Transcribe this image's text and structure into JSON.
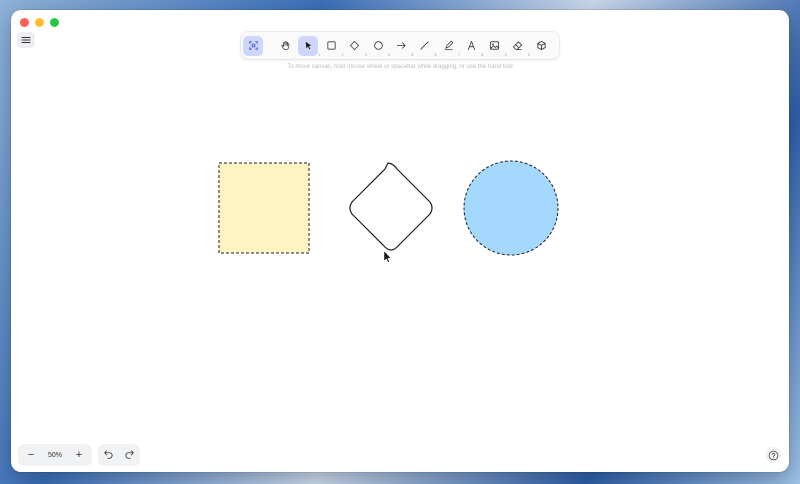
{
  "window": {
    "traffic_lights": [
      "close",
      "minimize",
      "maximize"
    ],
    "colors": {
      "close": "#ff5f57",
      "minimize": "#febc2e",
      "maximize": "#28c840"
    }
  },
  "toolbar": {
    "tools": [
      {
        "name": "lock-tool",
        "icon": "lock-icon",
        "shortcut": "",
        "active": true
      },
      {
        "name": "hand-tool",
        "icon": "hand-icon",
        "shortcut": "",
        "active": false
      },
      {
        "name": "selection-tool",
        "icon": "pointer-icon",
        "shortcut": "1",
        "active": true
      },
      {
        "name": "rectangle-tool",
        "icon": "square-icon",
        "shortcut": "2",
        "active": false
      },
      {
        "name": "diamond-tool",
        "icon": "diamond-icon",
        "shortcut": "3",
        "active": false
      },
      {
        "name": "ellipse-tool",
        "icon": "circle-icon",
        "shortcut": "4",
        "active": false
      },
      {
        "name": "arrow-tool",
        "icon": "arrow-icon",
        "shortcut": "5",
        "active": false
      },
      {
        "name": "line-tool",
        "icon": "line-icon",
        "shortcut": "6",
        "active": false
      },
      {
        "name": "draw-tool",
        "icon": "pen-icon",
        "shortcut": "7",
        "active": false
      },
      {
        "name": "text-tool",
        "icon": "text-icon",
        "shortcut": "8",
        "active": false
      },
      {
        "name": "image-tool",
        "icon": "image-icon",
        "shortcut": "9",
        "active": false
      },
      {
        "name": "eraser-tool",
        "icon": "eraser-icon",
        "shortcut": "0",
        "active": false
      },
      {
        "name": "library-tool",
        "icon": "cube-icon",
        "shortcut": "",
        "active": false
      }
    ],
    "active_color": "#cfd6fb"
  },
  "hint": {
    "text": "To move canvas, hold mouse wheel or spacebar while dragging, or use the hand tool"
  },
  "canvas": {
    "shapes": [
      {
        "type": "rectangle",
        "fill": "#fff3c4",
        "stroke": "#1e1e1e",
        "stroke_style": "dashed"
      },
      {
        "type": "diamond",
        "fill": "#ffffff",
        "stroke": "#1e1e1e",
        "stroke_style": "solid"
      },
      {
        "type": "ellipse",
        "fill": "#a5d8ff",
        "stroke": "#1e1e1e",
        "stroke_style": "dashed"
      }
    ]
  },
  "footer": {
    "zoom_out_label": "−",
    "zoom_value": "50%",
    "zoom_in_label": "+",
    "undo_icon": "undo-icon",
    "redo_icon": "redo-icon",
    "help_icon": "help-icon"
  }
}
